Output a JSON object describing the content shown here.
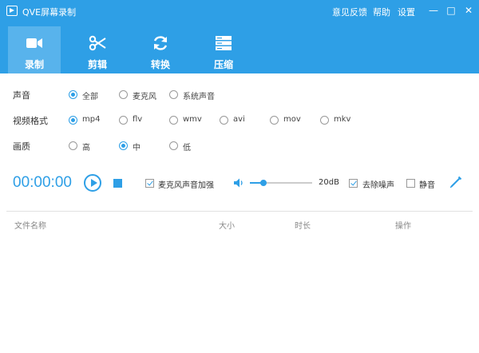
{
  "window": {
    "title": "QVE屏幕录制",
    "links": [
      "意见反馈",
      "帮助",
      "设置"
    ]
  },
  "tabs": [
    {
      "label": "录制",
      "icon": "video-camera-icon",
      "active": true
    },
    {
      "label": "剪辑",
      "icon": "scissors-icon",
      "active": false
    },
    {
      "label": "转换",
      "icon": "refresh-icon",
      "active": false
    },
    {
      "label": "压缩",
      "icon": "compress-icon",
      "active": false
    }
  ],
  "settings": {
    "sound": {
      "label": "声音",
      "options": [
        "全部",
        "麦克风",
        "系统声音"
      ],
      "selected": "全部"
    },
    "format": {
      "label": "视频格式",
      "options": [
        "mp4",
        "flv",
        "wmv",
        "avi",
        "mov",
        "mkv"
      ],
      "selected": "mp4"
    },
    "quality": {
      "label": "画质",
      "options": [
        "高",
        "中",
        "低"
      ],
      "selected": "中"
    }
  },
  "controls": {
    "timer": "00:00:00",
    "mic_boost": {
      "label": "麦克风声音加强",
      "checked": true
    },
    "volume": {
      "value": "20dB",
      "level": 0.22
    },
    "noise_reduction": {
      "label": "去除噪声",
      "checked": true
    },
    "mute": {
      "label": "静音",
      "checked": false
    }
  },
  "table": {
    "columns": [
      "文件名称",
      "大小",
      "时长",
      "操作"
    ]
  },
  "colors": {
    "accent": "#2e9fe6",
    "active_tab": "#58b3ec"
  }
}
